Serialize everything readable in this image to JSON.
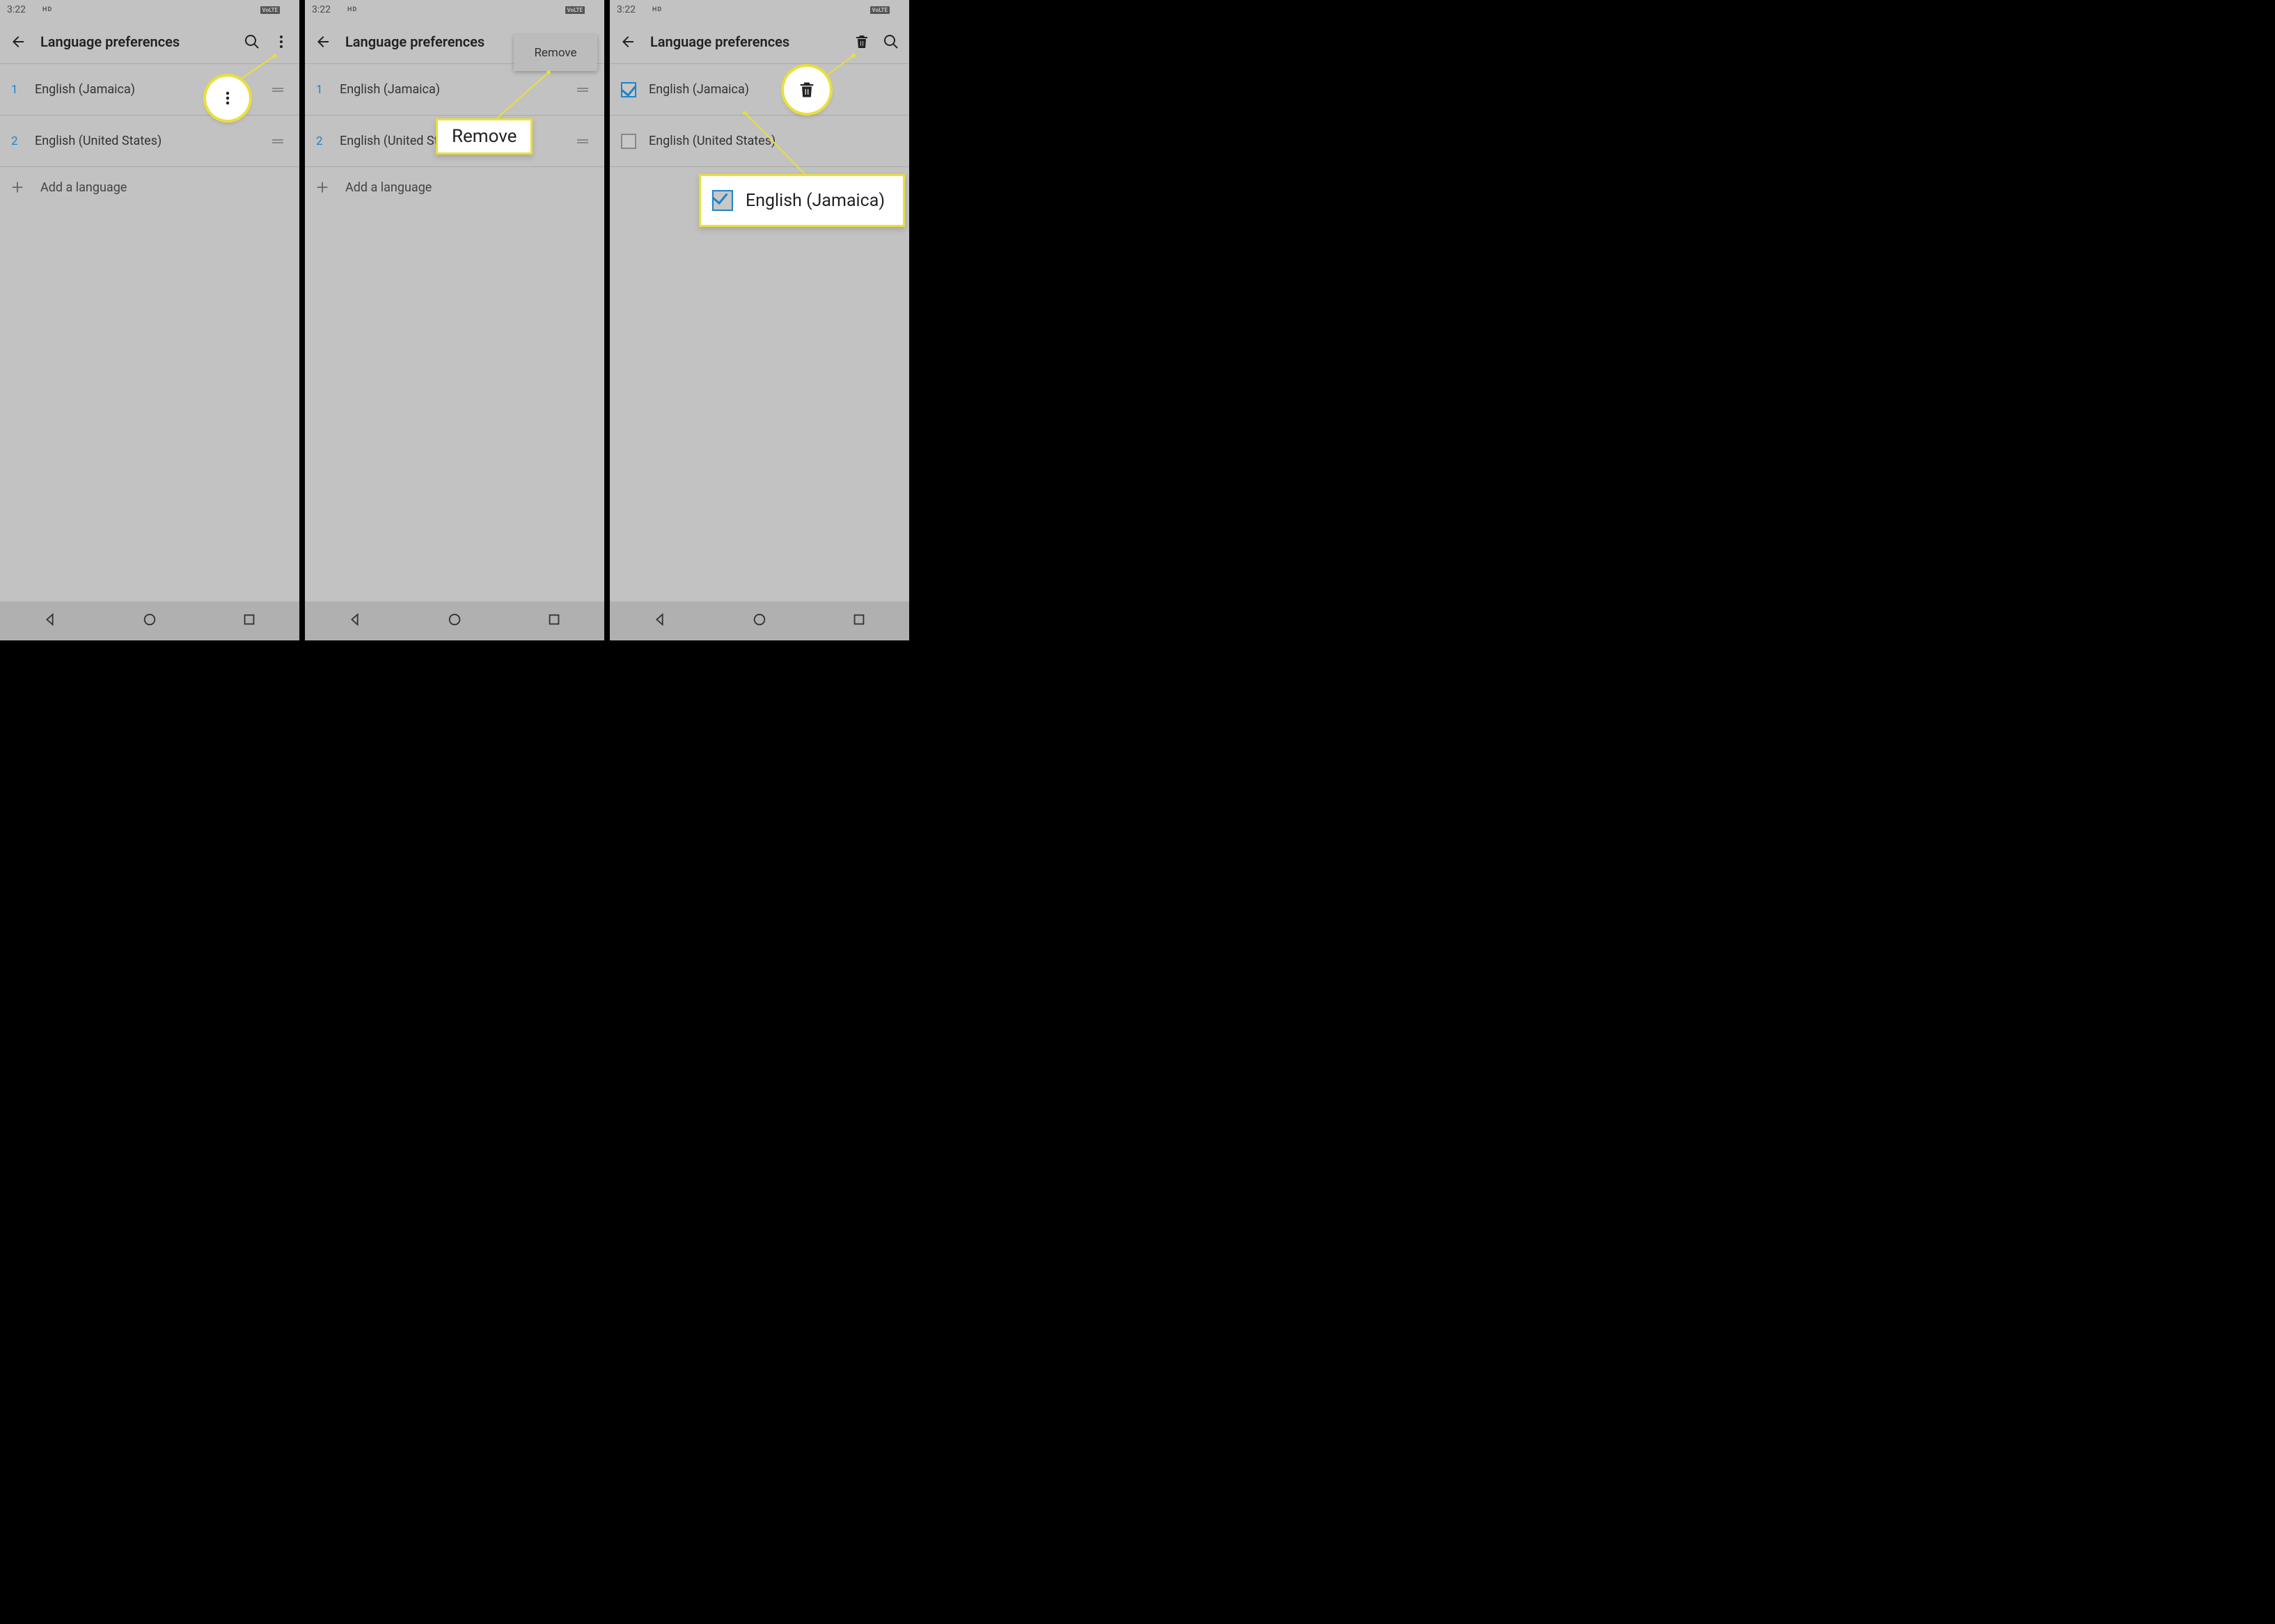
{
  "status": {
    "time": "3:22",
    "hd": "HD"
  },
  "screens": {
    "a": {
      "title": "Language preferences",
      "rows": [
        {
          "index": "1",
          "label": "English (Jamaica)"
        },
        {
          "index": "2",
          "label": "English (United States)"
        }
      ],
      "add_label": "Add a language"
    },
    "b": {
      "title": "Language preferences",
      "menu_item": "Remove",
      "rows": [
        {
          "index": "1",
          "label": "English (Jamaica)"
        },
        {
          "index": "2",
          "label": "English (United States)"
        }
      ],
      "add_label": "Add a language",
      "callout_remove": "Remove"
    },
    "c": {
      "title": "Language preferences",
      "rows": [
        {
          "checked": true,
          "label": "English (Jamaica)"
        },
        {
          "checked": false,
          "label": "English (United States)"
        }
      ],
      "callout_item": "English (Jamaica)"
    }
  }
}
